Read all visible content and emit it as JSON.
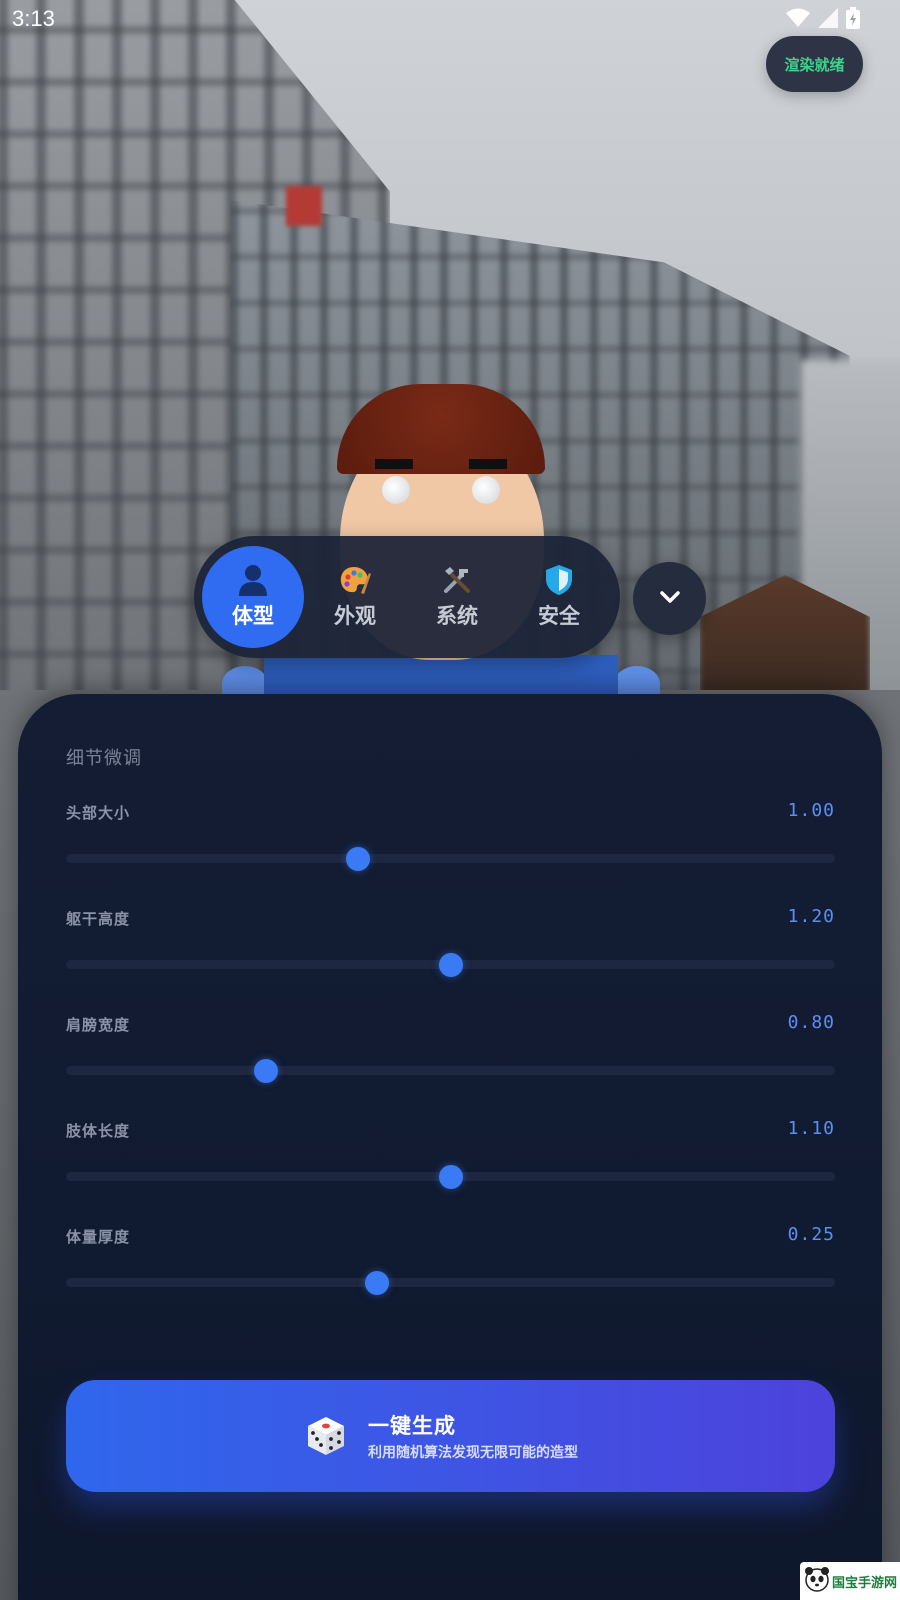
{
  "status_bar": {
    "time": "3:13"
  },
  "render_status": {
    "label": "渲染就绪",
    "color": "#3ed28a"
  },
  "tabs": [
    {
      "label": "体型",
      "icon": "person-icon",
      "active": true
    },
    {
      "label": "外观",
      "icon": "palette-icon",
      "active": false
    },
    {
      "label": "系统",
      "icon": "tools-icon",
      "active": false
    },
    {
      "label": "安全",
      "icon": "shield-icon",
      "active": false
    }
  ],
  "panel": {
    "title": "细节微调",
    "sliders": [
      {
        "label": "头部大小",
        "value": "1.00",
        "fraction": 0.38
      },
      {
        "label": "躯干高度",
        "value": "1.20",
        "fraction": 0.5
      },
      {
        "label": "肩膀宽度",
        "value": "0.80",
        "fraction": 0.26
      },
      {
        "label": "肢体长度",
        "value": "1.10",
        "fraction": 0.5
      },
      {
        "label": "体量厚度",
        "value": "0.25",
        "fraction": 0.405
      }
    ]
  },
  "generate_button": {
    "title": "一键生成",
    "subtitle": "利用随机算法发现无限可能的造型",
    "icon": "dice-icon"
  },
  "watermark": {
    "text": "国宝手游网"
  },
  "colors": {
    "accent": "#2f6cf2",
    "slider_thumb": "#3a7bf5",
    "value_text": "#5c8ff2",
    "panel_bg": "#121b31"
  }
}
